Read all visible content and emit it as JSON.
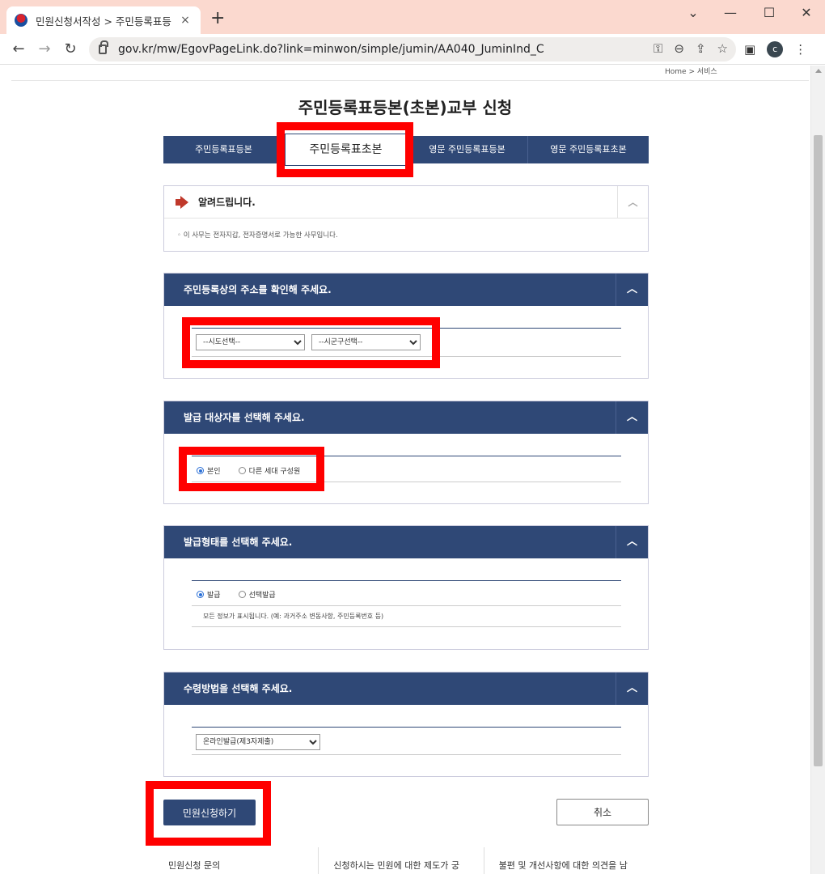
{
  "browser": {
    "tab_title": "민원신청서작성 > 주민등록표등",
    "tab_close": "×",
    "new_tab": "+",
    "win_min": "⌄",
    "win_minimize": "—",
    "win_maximize": "☐",
    "win_close": "✕",
    "back": "←",
    "forward": "→",
    "reload": "↻",
    "url": "gov.kr/mw/EgovPageLink.do?link=minwon/simple/jumin/AA040_JuminInd_C",
    "omni_icons": [
      "key-icon",
      "zoom-icon",
      "share-icon",
      "star-icon"
    ],
    "avatar_letter": "c"
  },
  "breadcrumb": "Home > 서비스",
  "page_title": "주민등록표등본(초본)교부 신청",
  "tabs": [
    {
      "label": "주민등록표등본"
    },
    {
      "label": "주민등록표초본",
      "active": true
    },
    {
      "label": "영문 주민등록표등본"
    },
    {
      "label": "영문 주민등록표초본"
    }
  ],
  "notice": {
    "title": "알려드립니다.",
    "body": "◦ 이 사무는 전자지갑, 전자증명서로 가능한 사무입니다."
  },
  "address_section": {
    "title": "주민등록상의 주소를 확인해 주세요.",
    "sido_selected": "--시도선택--",
    "sigungu_selected": "--시군구선택--"
  },
  "target_section": {
    "title": "발급 대상자를 선택해 주세요.",
    "options": [
      "본인",
      "다른 세대 구성원"
    ],
    "selected": "본인"
  },
  "form_section": {
    "title": "발급형태를 선택해 주세요.",
    "options": [
      "발급",
      "선택발급"
    ],
    "selected": "발급",
    "note": "모든 정보가 표시됩니다. (예: 과거주소 변동사항, 주민등록번호 등)"
  },
  "receive_section": {
    "title": "수령방법을 선택해 주세요.",
    "selected": "온라인발급(제3자제출)"
  },
  "buttons": {
    "submit": "민원신청하기",
    "cancel": "취소"
  },
  "footer": [
    "민원신청 문의",
    "신청하시는 민원에 대한 제도가 궁",
    "불편 및 개선사항에 대한 의견을 남"
  ],
  "colors": {
    "navy": "#2f4876",
    "highlight": "#ff0000",
    "titlebar": "#fbd9cf"
  }
}
